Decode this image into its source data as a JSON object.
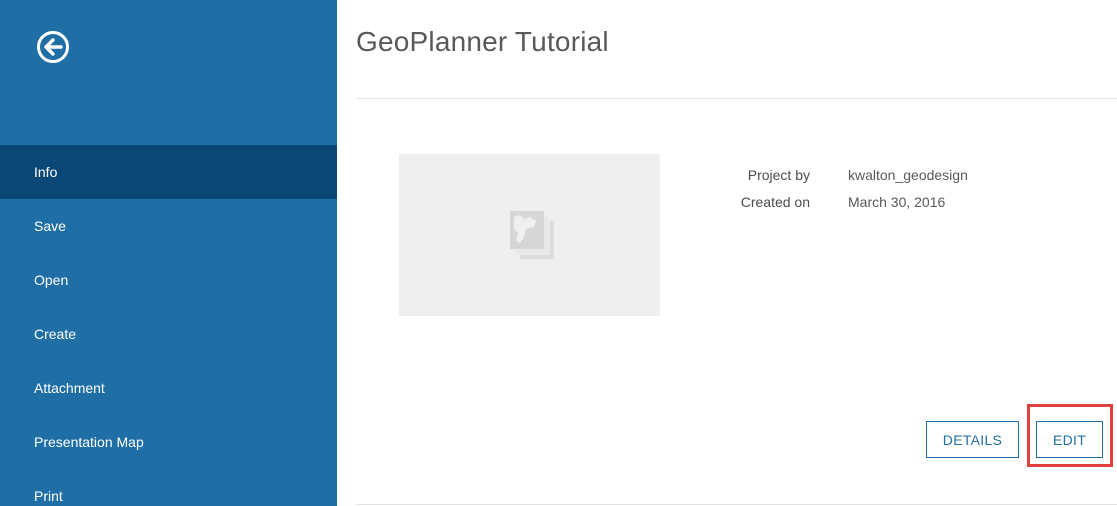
{
  "page": {
    "title": "GeoPlanner Tutorial"
  },
  "sidebar": {
    "back_icon": "back-arrow-circle-icon",
    "items": [
      {
        "label": "Info",
        "active": true
      },
      {
        "label": "Save"
      },
      {
        "label": "Open"
      },
      {
        "label": "Create"
      },
      {
        "label": "Attachment"
      },
      {
        "label": "Presentation Map"
      },
      {
        "label": "Print"
      }
    ]
  },
  "project": {
    "thumbnail_icon": "map-layers-icon",
    "project_by_label": "Project by",
    "project_by_value": "kwalton_geodesign",
    "created_on_label": "Created on",
    "created_on_value": "March 30, 2016"
  },
  "actions": {
    "details_label": "DETAILS",
    "edit_label": "EDIT"
  },
  "colors": {
    "sidebar": "#1f6ea6",
    "sidebar_active": "#0a4776",
    "accent": "#1f6ea6",
    "highlight": "#e0403c"
  }
}
